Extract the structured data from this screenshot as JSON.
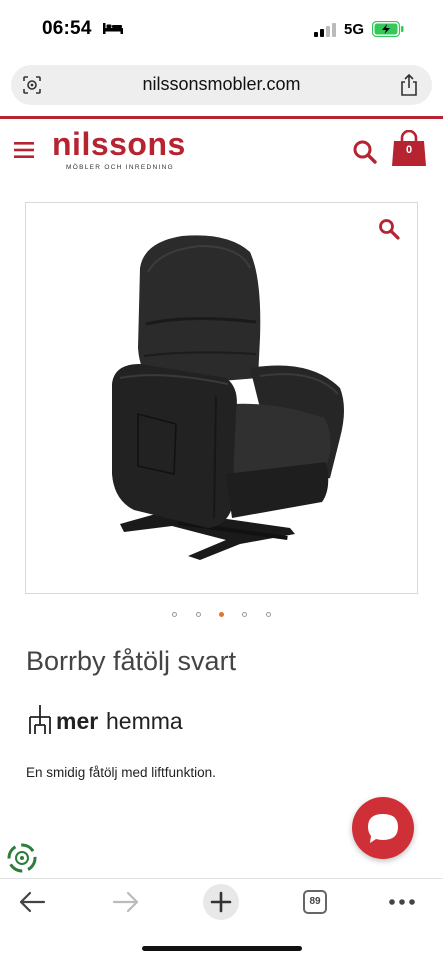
{
  "status_bar": {
    "time": "06:54",
    "network": "5G",
    "battery_color": "#34c759"
  },
  "browser": {
    "url": "nilssonsmobler.com",
    "tabs_count": "89"
  },
  "site": {
    "logo": "nilssons",
    "logo_sub": "MÖBLER OCH INREDNING",
    "cart_count": "0",
    "brand_color": "#b52430"
  },
  "product": {
    "title": "Borrby fåtölj svart",
    "brand_part1": "mer",
    "brand_part2": "hemma",
    "description": "En smidig fåtölj med liftfunktion.",
    "gallery_active_index": 2,
    "gallery_count": 5
  },
  "icons": [
    "bed-icon",
    "signal-icon",
    "battery-icon",
    "shield-icon",
    "share-icon",
    "menu-icon",
    "search-icon",
    "cart-icon",
    "zoom-icon",
    "chat-icon",
    "recycle-icon",
    "back-icon",
    "forward-icon",
    "plus-icon",
    "tabs-icon",
    "more-icon"
  ]
}
